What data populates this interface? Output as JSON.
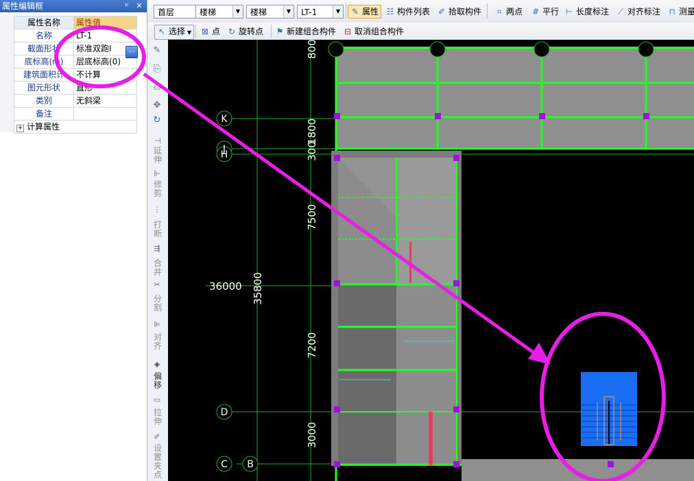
{
  "panel": {
    "title": "属性编辑框",
    "pin_glyph": "ᵖ",
    "close_glyph": "✕",
    "header_name": "属性名称",
    "header_value": "属性值",
    "rows": [
      {
        "name": "名称",
        "value": "LT-1"
      },
      {
        "name": "截面形状",
        "value": "标准双跑I"
      },
      {
        "name": "底标高(m)",
        "value": "层底标高(0)"
      },
      {
        "name": "建筑面积计",
        "value": "不计算"
      },
      {
        "name": "图元形状",
        "value": "直形"
      },
      {
        "name": "类别",
        "value": "无斜梁"
      },
      {
        "name": "备注",
        "value": ""
      }
    ],
    "calc_row": "计算属性",
    "ellipsis": "…"
  },
  "toolbar1": {
    "floor": "首层",
    "type": "楼梯",
    "subtype": "楼梯",
    "component": "LT-1",
    "properties": "属性",
    "component_list": "构件列表",
    "pick_component": "拾取构件",
    "two_point": "两点",
    "parallel": "平行",
    "length_dim": "长度标注",
    "align_dim": "对齐标注",
    "measure": "测量"
  },
  "toolbar2": {
    "select": "选择",
    "point": "点",
    "rotate_point": "旋转点",
    "new_group": "新建组合构件",
    "cancel_group": "取消组合构件"
  },
  "vtools": [
    {
      "label": "延伸",
      "icon": "extend-icon",
      "active": false
    },
    {
      "label": "修剪",
      "icon": "trim-icon",
      "active": false
    },
    {
      "label": "打断",
      "icon": "break-icon",
      "active": false
    },
    {
      "label": "合并",
      "icon": "merge-icon",
      "active": false
    },
    {
      "label": "分割",
      "icon": "split-icon",
      "active": false
    },
    {
      "label": "对齐",
      "icon": "align-icon",
      "active": false
    },
    {
      "label": "偏移",
      "icon": "offset-icon",
      "active": true
    },
    {
      "label": "拉伸",
      "icon": "stretch-icon",
      "active": false
    },
    {
      "label": "设置夹点",
      "icon": "grip-icon",
      "active": false
    }
  ],
  "drawing": {
    "axis_labels": [
      "K",
      "J",
      "H",
      "D",
      "C",
      "B"
    ],
    "dimensions": [
      "800",
      "300",
      "1800",
      "7500",
      "7200",
      "3000"
    ],
    "total_dims": [
      "36000",
      "35800"
    ]
  },
  "colors": {
    "grid": "#1fae1f",
    "beam": "#22ff22",
    "wall": "#8f8f8f",
    "annotation": "#e61ee6",
    "node": "#a010e0",
    "stair_icon": "#1a6ef5"
  }
}
